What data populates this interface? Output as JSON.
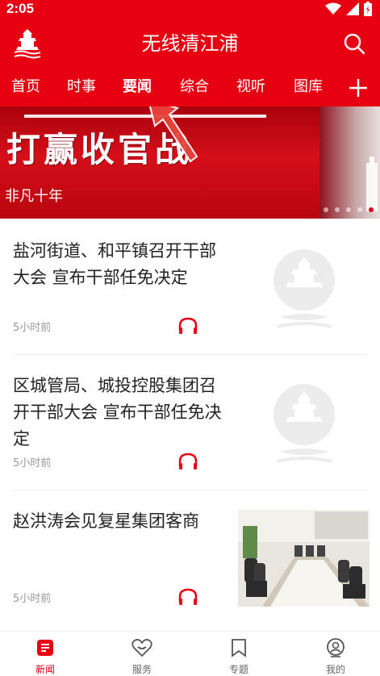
{
  "status_bar": {
    "time": "2:05"
  },
  "app": {
    "title": "无线清江浦"
  },
  "tabs": [
    {
      "label": "首页"
    },
    {
      "label": "时事"
    },
    {
      "label": "要闻"
    },
    {
      "label": "综合"
    },
    {
      "label": "视听"
    },
    {
      "label": "图库"
    }
  ],
  "active_tab": "要闻",
  "banner": {
    "headline": "打赢收官战",
    "caption": "非凡十年",
    "slide_count": 5,
    "active_slide": 5
  },
  "news": [
    {
      "title": "盐河街道、和平镇召开干部大会 宣布干部任免决定",
      "time": "5小时前",
      "thumbnail": "placeholder-logo"
    },
    {
      "title": "区城管局、城投控股集团召开干部大会 宣布干部任免决定",
      "time": "5小时前",
      "thumbnail": "placeholder-logo"
    },
    {
      "title": "赵洪涛会见复星集团客商",
      "time": "5小时前",
      "thumbnail": "meeting-photo"
    }
  ],
  "bottom_nav": [
    {
      "label": "新闻",
      "icon": "news-icon",
      "active": true
    },
    {
      "label": "服务",
      "icon": "heart-icon",
      "active": false
    },
    {
      "label": "专题",
      "icon": "bookmark-icon",
      "active": false
    },
    {
      "label": "我的",
      "icon": "profile-icon",
      "active": false
    }
  ],
  "colors": {
    "brand_red": "#e60012",
    "time_gray": "#999999"
  }
}
